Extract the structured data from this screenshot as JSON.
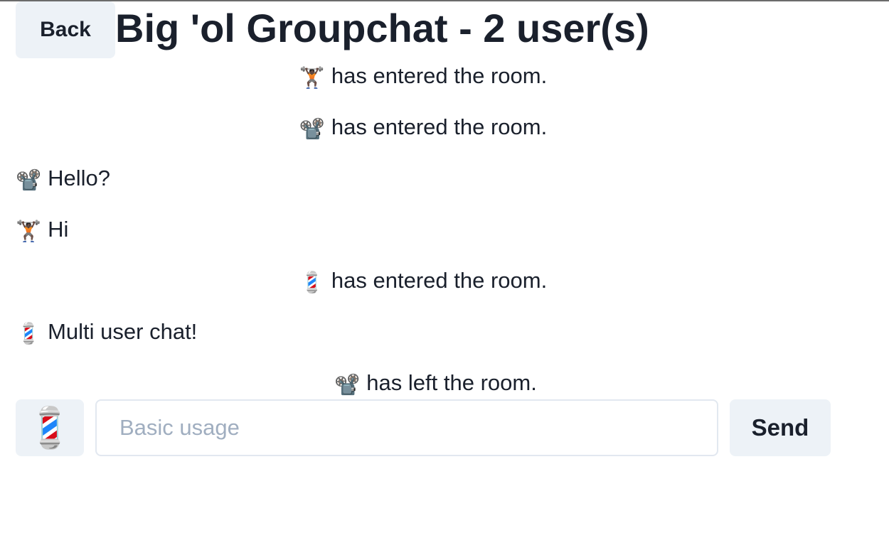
{
  "header": {
    "back_label": "Back",
    "title": "Big 'ol Groupchat - 2 user(s)"
  },
  "messages": [
    {
      "type": "system",
      "avatar": "🏋🏿",
      "avatar_name": "weightlifter-emoji",
      "text": "has entered the room."
    },
    {
      "type": "system",
      "avatar": "📽️",
      "avatar_name": "film-projector-emoji",
      "text": "has entered the room."
    },
    {
      "type": "chat",
      "avatar": "📽️",
      "avatar_name": "film-projector-emoji",
      "text": "Hello?"
    },
    {
      "type": "chat",
      "avatar": "🏋🏿",
      "avatar_name": "weightlifter-emoji",
      "text": "Hi"
    },
    {
      "type": "system",
      "avatar": "💈",
      "avatar_name": "barber-pole-emoji",
      "text": "has entered the room."
    },
    {
      "type": "chat",
      "avatar": "💈",
      "avatar_name": "barber-pole-emoji",
      "text": "Multi user chat!"
    },
    {
      "type": "system",
      "avatar": "📽️",
      "avatar_name": "film-projector-emoji",
      "text": "has left the room."
    }
  ],
  "composer": {
    "emoji": "💈",
    "emoji_name": "barber-pole-emoji",
    "input_value": "",
    "placeholder": "Basic usage",
    "send_label": "Send"
  },
  "colors": {
    "button_bg": "#edf2f7",
    "text": "#1a202c",
    "placeholder": "#a0aec0",
    "input_border": "#e2e8f0"
  }
}
